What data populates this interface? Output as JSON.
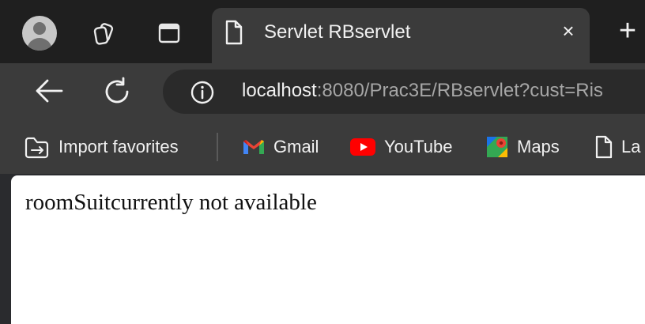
{
  "tab": {
    "title": "Servlet RBservlet",
    "close_label": "×",
    "new_tab_label": "+"
  },
  "address_bar": {
    "host": "localhost",
    "path": ":8080/Prac3E/RBservlet?cust=Ris"
  },
  "bookmarks": [
    {
      "label": "Import favorites",
      "icon": "import-favorites-icon"
    },
    {
      "label": "Gmail",
      "icon": "gmail-icon"
    },
    {
      "label": "YouTube",
      "icon": "youtube-icon"
    },
    {
      "label": "Maps",
      "icon": "maps-icon"
    },
    {
      "label": "La",
      "icon": "page-icon"
    }
  ],
  "page": {
    "message": "roomSuitcurrently not available"
  },
  "colors": {
    "tab_strip": "#1f1f1f",
    "toolbar": "#3b3b3b",
    "omnibox": "#2a2a2a",
    "youtube_red": "#ff0000"
  }
}
